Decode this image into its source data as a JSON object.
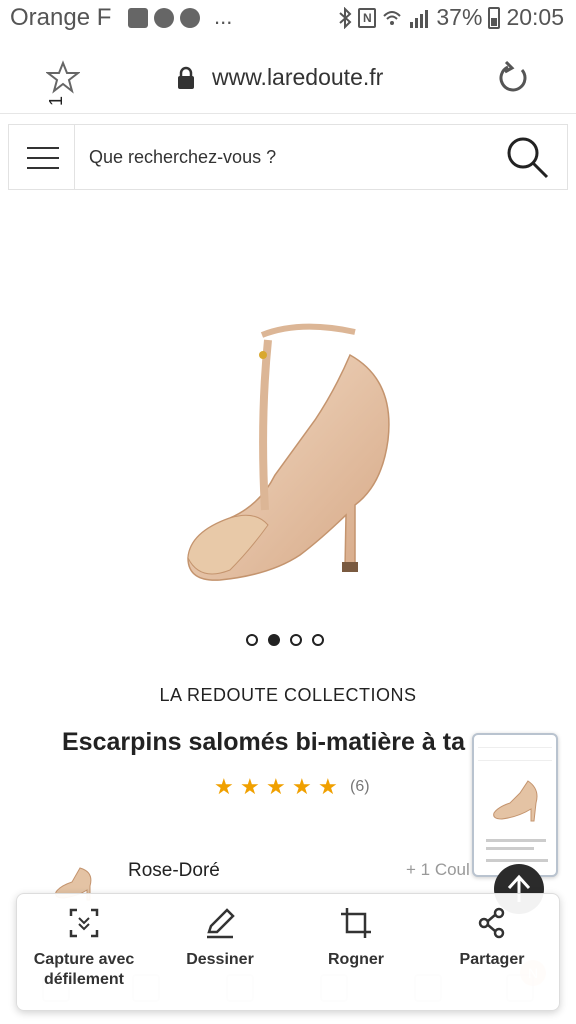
{
  "status_bar": {
    "carrier": "Orange F",
    "ellipsis": "...",
    "battery": "37%",
    "time": "20:05"
  },
  "browser": {
    "url": "www.laredoute.fr",
    "page_marker": "1"
  },
  "search": {
    "placeholder": "Que recherchez-vous ?"
  },
  "product": {
    "brand": "LA REDOUTE COLLECTIONS",
    "title": "Escarpins salomés bi-matière à ta",
    "rating_stars": 5,
    "rating_count": "(6)",
    "carousel_active_index": 1,
    "carousel_count": 4,
    "color_name": "Rose-Doré",
    "more_colors": "+ 1 Coul"
  },
  "capture_toolbar": {
    "items": [
      {
        "label": "Capture avec défilement",
        "icon": "scroll-capture-icon"
      },
      {
        "label": "Dessiner",
        "icon": "pen-icon"
      },
      {
        "label": "Rogner",
        "icon": "crop-icon"
      },
      {
        "label": "Partager",
        "icon": "share-icon"
      }
    ]
  },
  "colors": {
    "star": "#f0a000",
    "shoe": "#e6c2a2",
    "text": "#222222"
  }
}
